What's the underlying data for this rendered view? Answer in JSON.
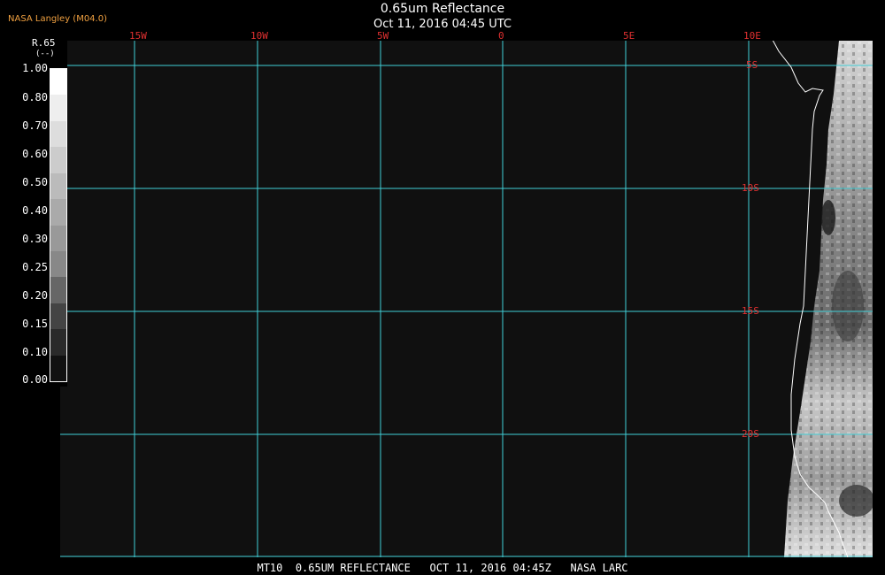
{
  "header": {
    "credit": "NASA Langley (M04.0)",
    "title": "0.65um Reflectance",
    "subtitle": "Oct 11, 2016 04:45 UTC"
  },
  "legend": {
    "title": "R.65",
    "unit": "(--)",
    "ticks": [
      "1.00",
      "0.80",
      "0.70",
      "0.60",
      "0.50",
      "0.40",
      "0.30",
      "0.25",
      "0.20",
      "0.15",
      "0.10",
      "0.00"
    ],
    "colors": [
      "#ffffff",
      "#eeeeee",
      "#dddddd",
      "#cccccc",
      "#bbbbbb",
      "#aaaaaa",
      "#999999",
      "#888888",
      "#666666",
      "#444444",
      "#2a2a2a",
      "#111111"
    ]
  },
  "map": {
    "lon_labels": [
      "15W",
      "10W",
      "5W",
      "0",
      "5E",
      "10E"
    ],
    "lat_labels": [
      "5S",
      "10S",
      "15S",
      "20S"
    ],
    "grid_color": "#40d0d8",
    "label_color": "#e03030"
  },
  "footer": "MT10  0.65UM REFLECTANCE   OCT 11, 2016 04:45Z   NASA LARC"
}
